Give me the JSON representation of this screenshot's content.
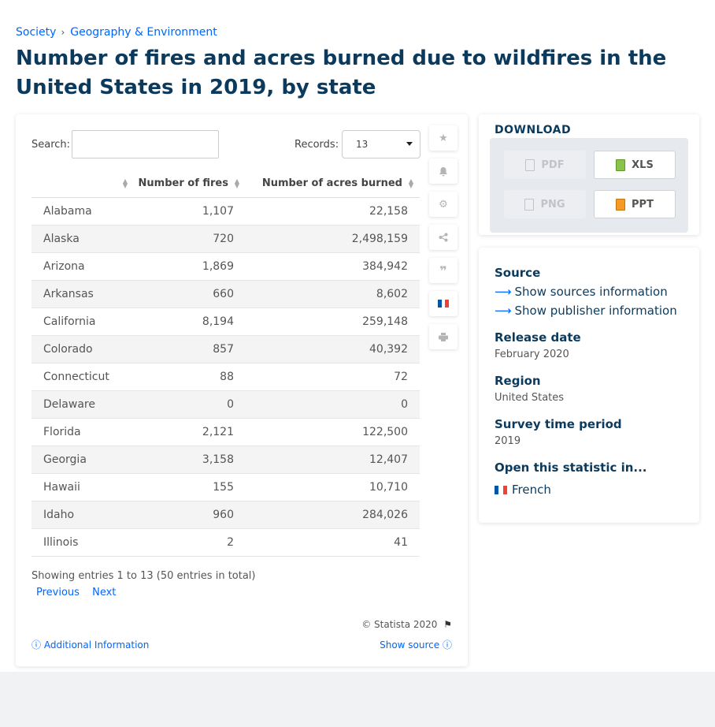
{
  "breadcrumb": {
    "items": [
      "Society",
      "Geography & Environment"
    ],
    "separator": "›"
  },
  "page_title": "Number of fires and acres burned due to wildfires in the United States in 2019, by state",
  "table_controls": {
    "search_label": "Search:",
    "search_value": "",
    "records_label": "Records:",
    "records_value": "13"
  },
  "table": {
    "headers": [
      "",
      "Number of fires",
      "Number of acres burned"
    ],
    "rows": [
      {
        "state": "Alabama",
        "fires": "1,107",
        "acres": "22,158"
      },
      {
        "state": "Alaska",
        "fires": "720",
        "acres": "2,498,159"
      },
      {
        "state": "Arizona",
        "fires": "1,869",
        "acres": "384,942"
      },
      {
        "state": "Arkansas",
        "fires": "660",
        "acres": "8,602"
      },
      {
        "state": "California",
        "fires": "8,194",
        "acres": "259,148"
      },
      {
        "state": "Colorado",
        "fires": "857",
        "acres": "40,392"
      },
      {
        "state": "Connecticut",
        "fires": "88",
        "acres": "72"
      },
      {
        "state": "Delaware",
        "fires": "0",
        "acres": "0"
      },
      {
        "state": "Florida",
        "fires": "2,121",
        "acres": "122,500"
      },
      {
        "state": "Georgia",
        "fires": "3,158",
        "acres": "12,407"
      },
      {
        "state": "Hawaii",
        "fires": "155",
        "acres": "10,710"
      },
      {
        "state": "Idaho",
        "fires": "960",
        "acres": "284,026"
      },
      {
        "state": "Illinois",
        "fires": "2",
        "acres": "41"
      }
    ]
  },
  "pagination": {
    "showing_text": "Showing entries 1 to 13 (50 entries in total)",
    "previous": "Previous",
    "next": "Next"
  },
  "footer": {
    "copyright": "© Statista 2020",
    "additional_info": "Additional Information",
    "show_source": "Show source"
  },
  "toolbar": {
    "icons": [
      "star-icon",
      "bell-icon",
      "gear-icon",
      "share-icon",
      "quote-icon",
      "french-flag-icon",
      "print-icon"
    ]
  },
  "download": {
    "title": "DOWNLOAD",
    "buttons": [
      {
        "label": "PDF",
        "enabled": false
      },
      {
        "label": "XLS",
        "enabled": true
      },
      {
        "label": "PNG",
        "enabled": false
      },
      {
        "label": "PPT",
        "enabled": true
      }
    ]
  },
  "info": {
    "source_heading": "Source",
    "show_sources": "Show sources information",
    "show_publisher": "Show publisher information",
    "release_date_heading": "Release date",
    "release_date": "February 2020",
    "region_heading": "Region",
    "region": "United States",
    "survey_period_heading": "Survey time period",
    "survey_period": "2019",
    "open_in_heading": "Open this statistic in...",
    "open_in_language": "French"
  },
  "colors": {
    "link": "#0066ff",
    "title": "#0c3a5c",
    "flag_blue": "#0055a4",
    "flag_white": "#ffffff",
    "flag_red": "#ef4135"
  }
}
